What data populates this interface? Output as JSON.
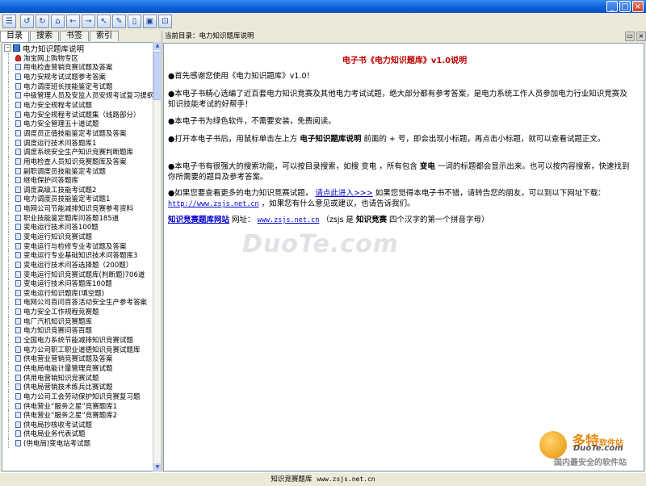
{
  "window": {
    "minimize": "_",
    "maximize": "□",
    "close": "×"
  },
  "toolbar": {
    "icons": [
      "menu-icon",
      "back-icon",
      "refresh-icon",
      "home-icon",
      "prev-icon",
      "next-icon",
      "pointer-icon",
      "pen-icon",
      "page-icon",
      "save-icon",
      "zoom-icon"
    ]
  },
  "tabs": [
    "目录",
    "搜索",
    "书签",
    "索引"
  ],
  "tree": {
    "root": "电力知识题库说明",
    "items": [
      "淘宝网上购物专区",
      "用电检查营销竞赛试题及答案",
      "电力安规考试试题参考答案",
      "电力调度班长技能鉴定考试题",
      "中级管理人员及安监人员安规考试复习提纲",
      "电力安全规程考试试题",
      "电力安全规程考试试题集（线路部分）",
      "电力安全管理五十道试题",
      "调度员正值技能鉴定考试题及答案",
      "调度运行技术问答题库1",
      "调度系统安全生产知识竞赛判断题库",
      "用电检查人员知识竞赛题库及答案",
      "副职调度员技能鉴定考试题",
      "继电保护问答题库",
      "调度高级工技能考试题2",
      "电力调度员技能鉴定考试题1",
      "电网公司节能减排知识竞赛参考资料",
      "职业技能鉴定题库问答题185道",
      "变电运行技术问答100题",
      "变电运行知识竞赛试题",
      "变电运行与检修专业考试题及答案",
      "变电运行专业基础知识技术问答题库3",
      "变电运行技术问答选择题（200题）",
      "变电运行知识竞赛试题库(判断题)706道",
      "变电运行技术问答题库100题",
      "变电运行知识题库(填空题)",
      "电网公司百问百答活动安全生产参考答案",
      "电力安全工作规程竞赛题",
      "电厂汽机知识竞赛题库",
      "电力知识竞赛问答百题",
      "全国电力系统节能减排知识竞赛试题",
      "电力公司职工职业道德知识竞赛试题库",
      "供电营业营销竞赛试题及答案",
      "供电局电能计量管理竞赛试题",
      "供用电营销知识竞赛试题",
      "供电局营销技术练兵比赛试题",
      "电力公司工会劳动保护知识竞赛复习题",
      "供电营业“服务之星”竞赛题库1",
      "供电营业“服务之星”竞赛题库2",
      "供电局抄核收考试试题",
      "供电局业务代表试题",
      "(供电局)变电站考试题"
    ]
  },
  "pathbar": {
    "label": "当前目录：电力知识题库说明"
  },
  "content": {
    "title": "电子书《电力知识题库》v1.0说明",
    "p1": "●首先感谢您使用《电力知识题库》v1.0！",
    "p2": "●本电子书精心选编了近百套电力知识竞赛及其他电力考试试题，绝大部分都有参考答案，是电力系统工作人员参加电力行业知识竞赛及知识技能考试的好帮手！",
    "p3": "●本电子书为绿色软件，不需要安装，免费阅读。",
    "p4a": "●打开本电子书后，用鼠标单击左上方",
    "p4b": "电子知识题库说明",
    "p4c": "前面的 + 号，即会出现小标题，再点击小标题，就可以查看试题正文。",
    "p5a": "●本电子书有很强大的搜索功能，可以按目录搜索，如搜 变电 ，所有包含",
    "p5b": "变电",
    "p5c": "一词的标题都会显示出来。也可以按内容搜索，快速找到你所需要的题目及参考答案。",
    "p6a": "●如果您要查看更多的电力知识竞赛试题，",
    "p6link": "请点此进入>>>",
    "p6b": "如果您觉得本电子书不错，请转告您的朋友，可以到以下网址下载：",
    "p6url": "http://www.zsjs.net.cn",
    "p6c": "，如果您有什么意见或建议，也请告诉我们。",
    "footer_site": "知识竞赛题库网站",
    "footer_label": "网址：",
    "footer_url": "www.zsjs.net.cn",
    "footer_note_a": "（zsjs 是",
    "footer_note_b": "知识竞赛",
    "footer_note_c": "四个汉字的第一个拼音字母）"
  },
  "watermark": "DuoTe.com",
  "logo": {
    "name": "多特",
    "suffix": "软件站",
    "site": "DuoTe.com",
    "slogan": "国内最安全的软件站"
  },
  "status": {
    "label": "知识竞赛题库",
    "url": "www.zsjs.net.cn"
  }
}
